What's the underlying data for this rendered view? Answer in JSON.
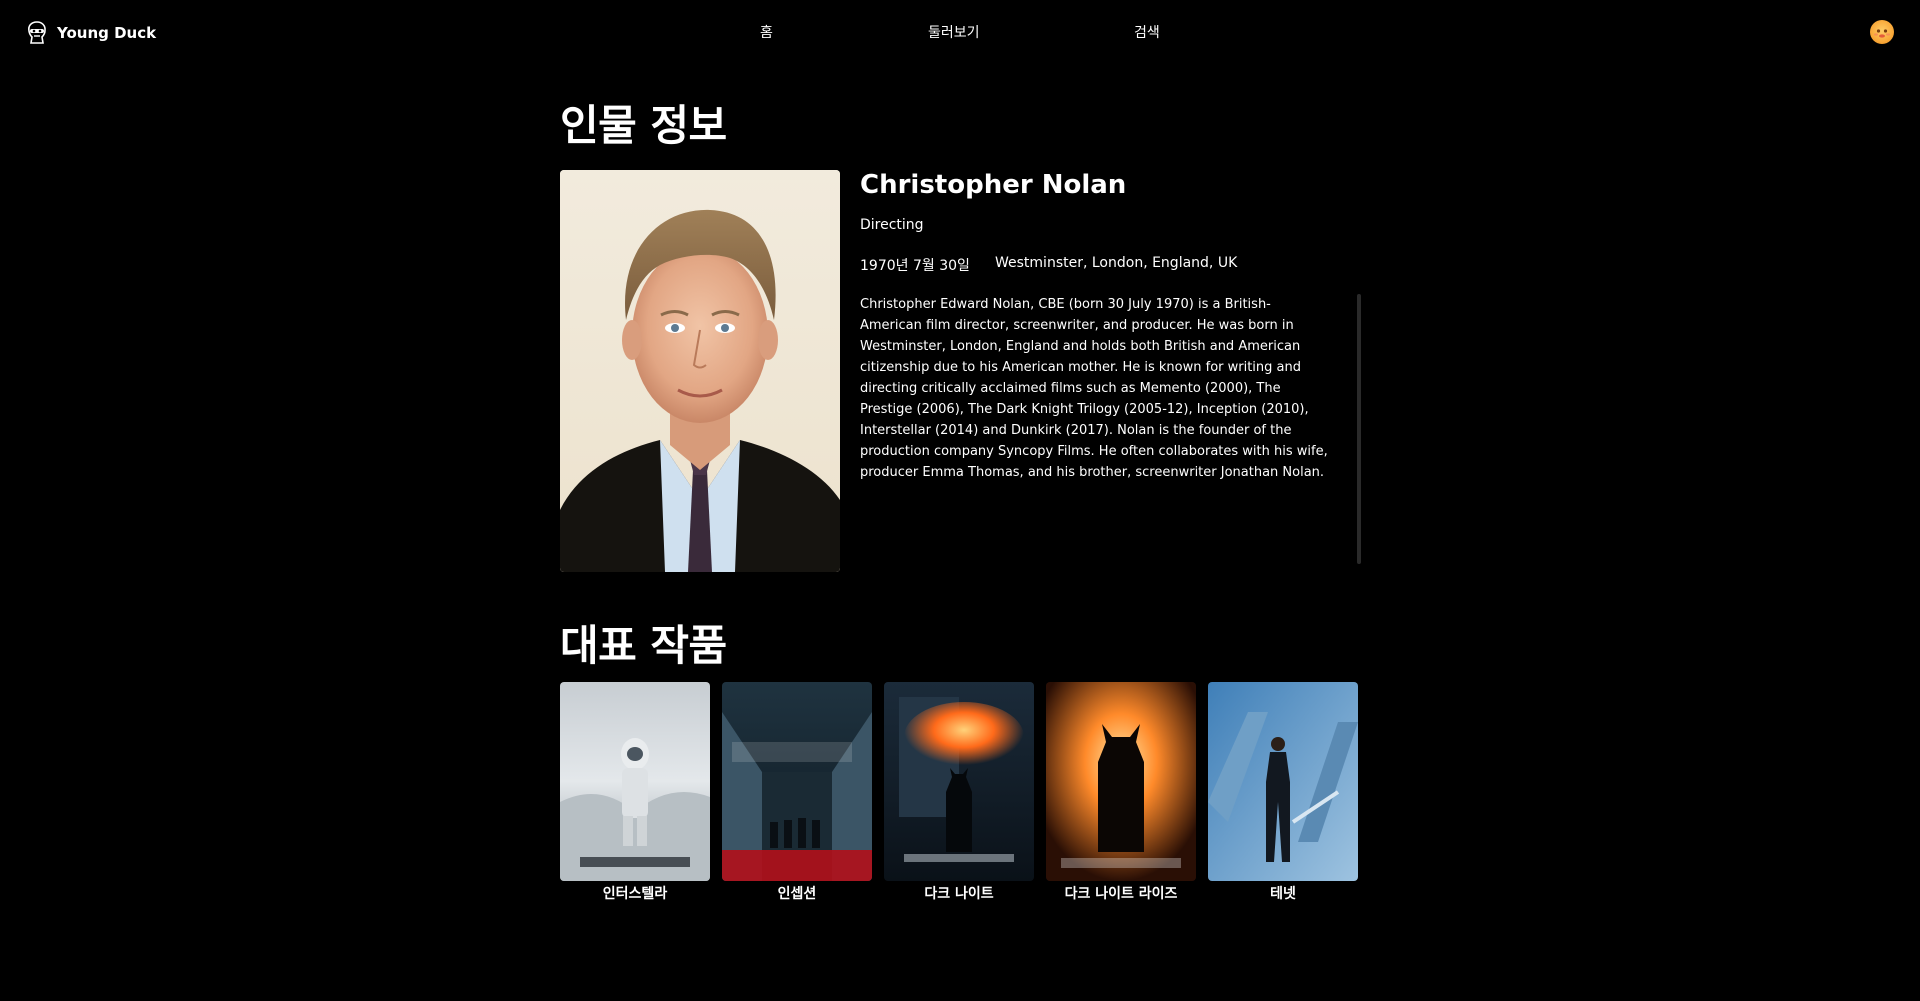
{
  "app": {
    "name": "Young Duck",
    "logo_icon": "duck-icon"
  },
  "nav": {
    "items": [
      {
        "label": "홈"
      },
      {
        "label": "둘러보기"
      },
      {
        "label": "검색"
      }
    ]
  },
  "user": {
    "avatar_icon": "user-avatar"
  },
  "person_section": {
    "title": "인물 정보"
  },
  "person": {
    "name": "Christopher Nolan",
    "department": "Directing",
    "birthday": "1970년 7월 30일",
    "place_of_birth": "Westminster, London, England, UK",
    "biography": "Christopher Edward Nolan, CBE (born 30 July 1970) is a British-American film director, screenwriter, and producer. He was born in Westminster, London, England and holds both British and American citizenship due to his American mother. He is known for writing and directing critically acclaimed films such as Memento (2000), The Prestige (2006), The Dark Knight Trilogy (2005-12), Inception (2010), Interstellar (2014) and Dunkirk (2017). Nolan is the founder of the production company Syncopy Films. He often collaborates with his wife, producer Emma Thomas, and his brother, screenwriter Jonathan Nolan."
  },
  "works_section": {
    "title": "대표 작품"
  },
  "works": [
    {
      "title": "인터스텔라"
    },
    {
      "title": "인셉션"
    },
    {
      "title": "다크 나이트"
    },
    {
      "title": "다크 나이트 라이즈"
    },
    {
      "title": "테넷"
    }
  ],
  "colors": {
    "background": "#000000",
    "text": "#ffffff",
    "avatar": "#f9a93a"
  }
}
